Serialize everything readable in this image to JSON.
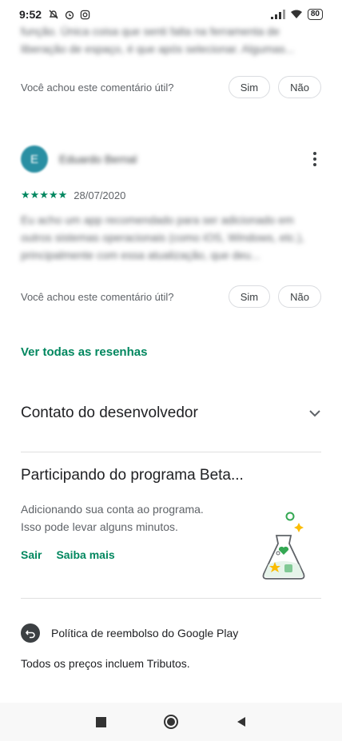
{
  "status_bar": {
    "time": "9:52",
    "battery": "80"
  },
  "review_top": {
    "text_blurred": "função. Única coisa que senti falta na ferramenta de liberação de espaço, é que após selecionar. Algumas..."
  },
  "helpful": {
    "question": "Você achou este comentário útil?",
    "yes": "Sim",
    "no": "Não"
  },
  "review2": {
    "avatar_initial": "E",
    "author_blurred": "Eduardo Bernal",
    "stars": "★★★★★",
    "date": "28/07/2020",
    "text_blurred": "Eu acho um app recomendado para ser adicionado em outros sistemas operacionais (como iOS, Windows, etc.), principalmente com essa atualização, que deu..."
  },
  "see_all_reviews": "Ver todas as resenhas",
  "developer_contact": "Contato do desenvolvedor",
  "beta": {
    "title": "Participando do programa Beta...",
    "desc_line1": "Adicionando sua conta ao programa.",
    "desc_line2": "Isso pode levar alguns minutos.",
    "leave": "Sair",
    "learn_more": "Saiba mais"
  },
  "refund_policy": "Política de reembolso do Google Play",
  "prices_note": "Todos os preços incluem Tributos.",
  "colors": {
    "accent": "#01875f",
    "avatar": "#2a8fa3"
  }
}
